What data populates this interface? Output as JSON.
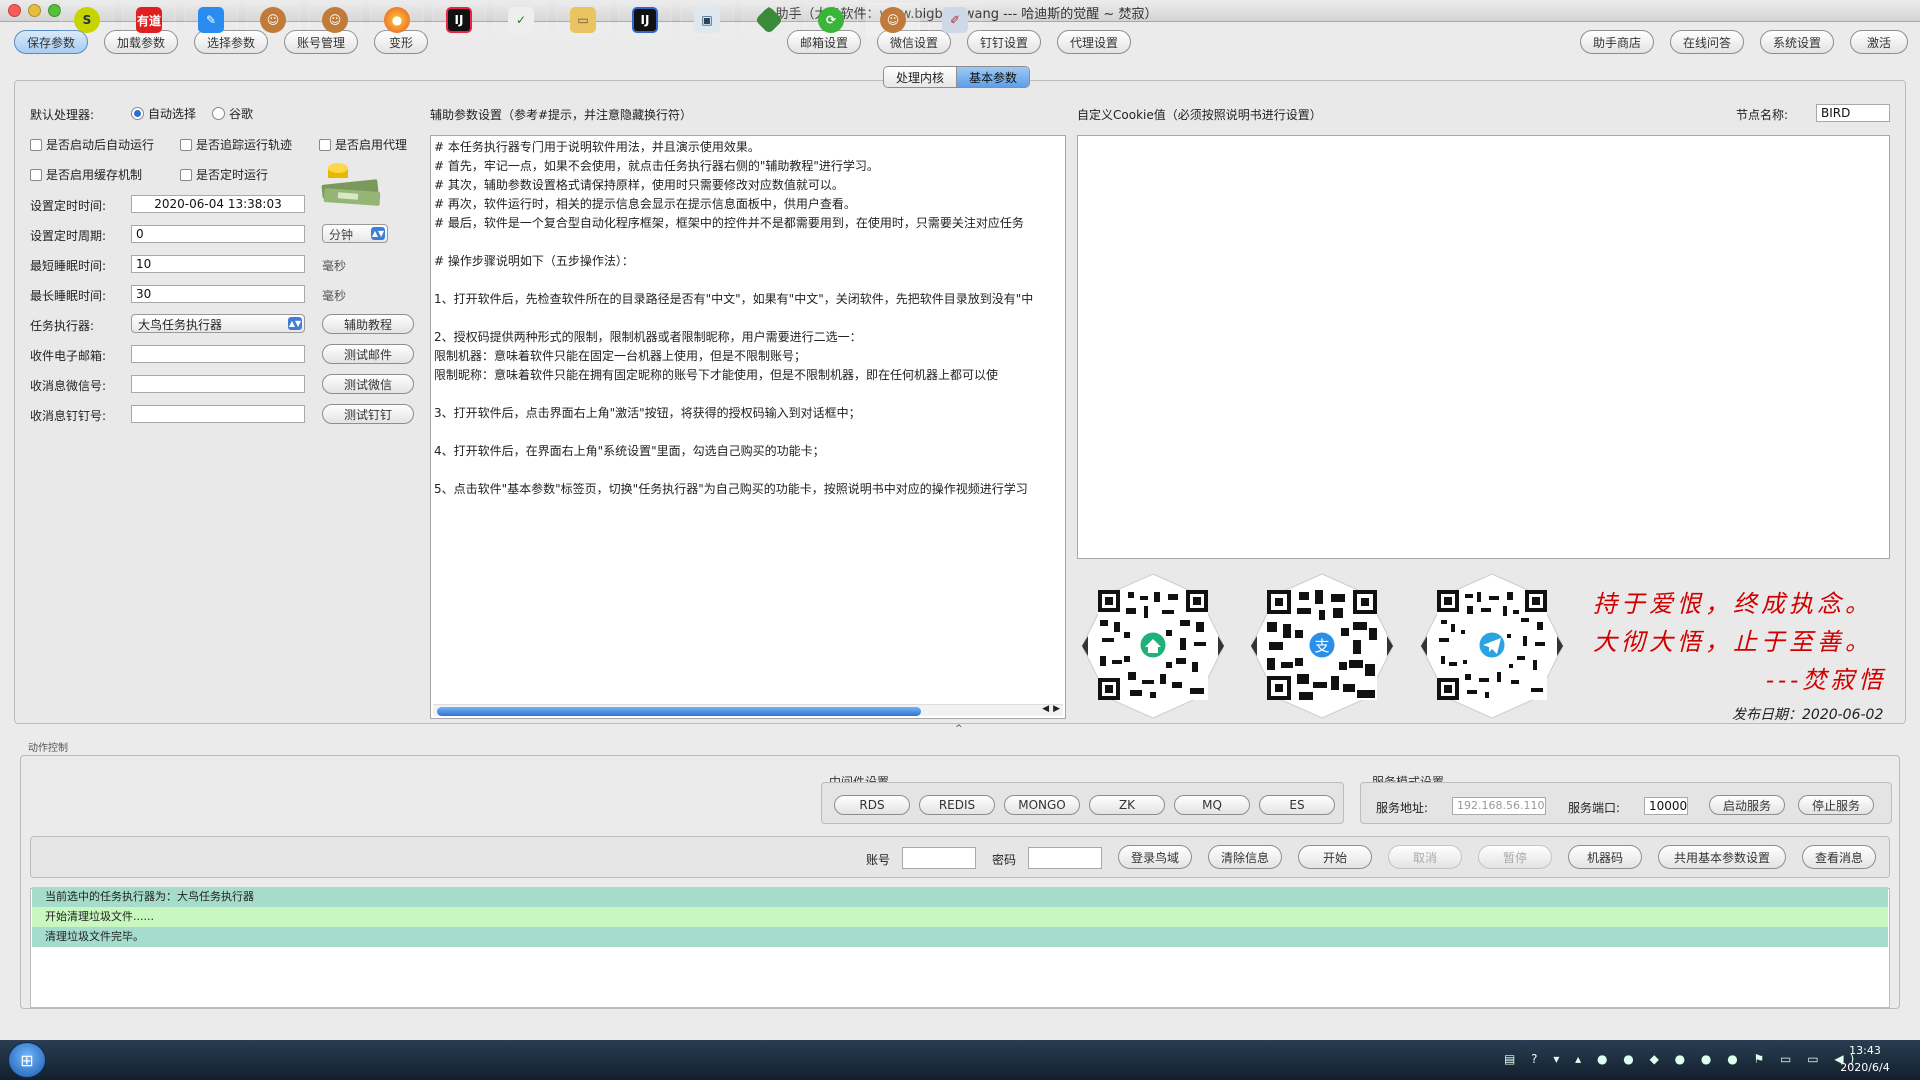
{
  "window": {
    "title": "小助手（大鸟软件：www.bigbird.wang --- 哈迪斯的觉醒 ~ 焚寂）"
  },
  "toolbar": {
    "left": [
      "保存参数",
      "加载参数",
      "选择参数",
      "账号管理",
      "变形"
    ],
    "center": [
      "邮箱设置",
      "微信设置",
      "钉钉设置",
      "代理设置"
    ],
    "right": [
      "助手商店",
      "在线问答",
      "系统设置",
      "激活"
    ]
  },
  "tabs": [
    "处理内核",
    "基本参数"
  ],
  "left_form": {
    "processor_label": "默认处理器:",
    "radio_auto": "自动选择",
    "radio_chrome": "谷歌",
    "chk1": "是否启动后自动运行",
    "chk2": "是否追踪运行轨迹",
    "chk3": "是否启用代理",
    "chk4": "是否启用缓存机制",
    "chk5": "是否定时运行",
    "time_label": "设置定时时间:",
    "time_value": "2020-06-04 13:38:03",
    "period_label": "设置定时周期:",
    "period_value": "0",
    "period_unit": "分钟",
    "min_sleep_label": "最短睡眠时间:",
    "min_sleep_value": "10",
    "ms1": "毫秒",
    "max_sleep_label": "最长睡眠时间:",
    "max_sleep_value": "30",
    "ms2": "毫秒",
    "executor_label": "任务执行器:",
    "executor_value": "大鸟任务执行器",
    "help_btn": "辅助教程",
    "email_label": "收件电子邮箱:",
    "email_btn": "测试邮件",
    "wechat_label": "收消息微信号:",
    "wechat_btn": "测试微信",
    "ding_label": "收消息钉钉号:",
    "ding_btn": "测试钉钉"
  },
  "aux": {
    "title": "辅助参数设置（参考#提示，并注意隐藏换行符）",
    "lines": [
      "# 本任务执行器专门用于说明软件用法，并且演示使用效果。",
      "# 首先，牢记一点，如果不会使用，就点击任务执行器右侧的\"辅助教程\"进行学习。",
      "# 其次，辅助参数设置格式请保持原样，使用时只需要修改对应数值就可以。",
      "# 再次，软件运行时，相关的提示信息会显示在提示信息面板中，供用户查看。",
      "# 最后，软件是一个复合型自动化程序框架，框架中的控件并不是都需要用到，在使用时，只需要关注对应任务",
      "",
      "# 操作步骤说明如下（五步操作法）：",
      "",
      "1、打开软件后，先检查软件所在的目录路径是否有\"中文\"，如果有\"中文\"，关闭软件，先把软件目录放到没有\"中",
      "",
      "2、授权码提供两种形式的限制，限制机器或者限制昵称，用户需要进行二选一：",
      "      限制机器：意味着软件只能在固定一台机器上使用，但是不限制账号；",
      "      限制昵称：意味着软件只能在拥有固定昵称的账号下才能使用，但是不限制机器，即在任何机器上都可以使",
      "",
      "3、打开软件后，点击界面右上角\"激活\"按钮，将获得的授权码输入到对话框中；",
      "",
      "4、打开软件后，在界面右上角\"系统设置\"里面，勾选自己购买的功能卡；",
      "",
      "5、点击软件\"基本参数\"标签页，切换\"任务执行器\"为自己购买的功能卡，按照说明书中对应的操作视频进行学习"
    ]
  },
  "cookie": {
    "title": "自定义Cookie值（必须按照说明书进行设置）",
    "node_label": "节点名称:",
    "node_value": "BIRD"
  },
  "poem": {
    "line1": "持于爱恨，终成执念。",
    "line2": "大彻大悟，止于至善。",
    "line3": "---焚寂悟",
    "date": "发布日期：2020-06-02"
  },
  "action": {
    "title": "动作控制",
    "middleware_title": "中间件设置",
    "middleware": [
      "RDS",
      "REDIS",
      "MONGO",
      "ZK",
      "MQ",
      "ES"
    ],
    "service_title": "服务模式设置",
    "addr_label": "服务地址:",
    "addr_value": "192.168.56.110",
    "port_label": "服务端口:",
    "port_value": "10000",
    "start_service": "启动服务",
    "stop_service": "停止服务",
    "account_label": "账号",
    "password_label": "密码",
    "buttons": [
      "登录鸟域",
      "清除信息",
      "开始",
      "取消",
      "暂停",
      "机器码",
      "共用基本参数设置",
      "查看消息"
    ]
  },
  "log": [
    "当前选中的任务执行器为：大鸟任务执行器",
    "开始清理垃圾文件......",
    "清理垃圾文件完毕。"
  ],
  "taskbar": {
    "time": "13:43",
    "date": "2020/6/4",
    "youdao": "有道"
  }
}
